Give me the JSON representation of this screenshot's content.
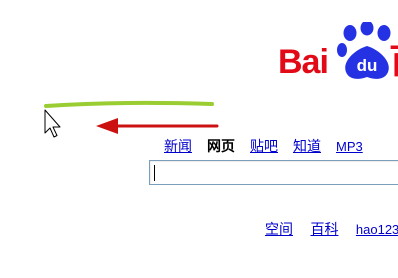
{
  "logo": {
    "text_before": "Bai",
    "paw_text": "du",
    "text_after": "百",
    "brand_red": "#e20a17",
    "paw_blue": "#2532e4"
  },
  "nav": {
    "items": [
      {
        "label": "新闻",
        "active": false
      },
      {
        "label": "网页",
        "active": true
      },
      {
        "label": "贴吧",
        "active": false
      },
      {
        "label": "知道",
        "active": false
      },
      {
        "label": "MP3",
        "active": false
      }
    ]
  },
  "search": {
    "value": "",
    "placeholder": ""
  },
  "bottom_links": [
    {
      "label": "空间"
    },
    {
      "label": "百科"
    },
    {
      "label": "hao123"
    }
  ],
  "annotations": {
    "highlight_color": "#9acd32",
    "arrow_color": "#cc1111",
    "cursor": "arrow-cursor-icon"
  }
}
